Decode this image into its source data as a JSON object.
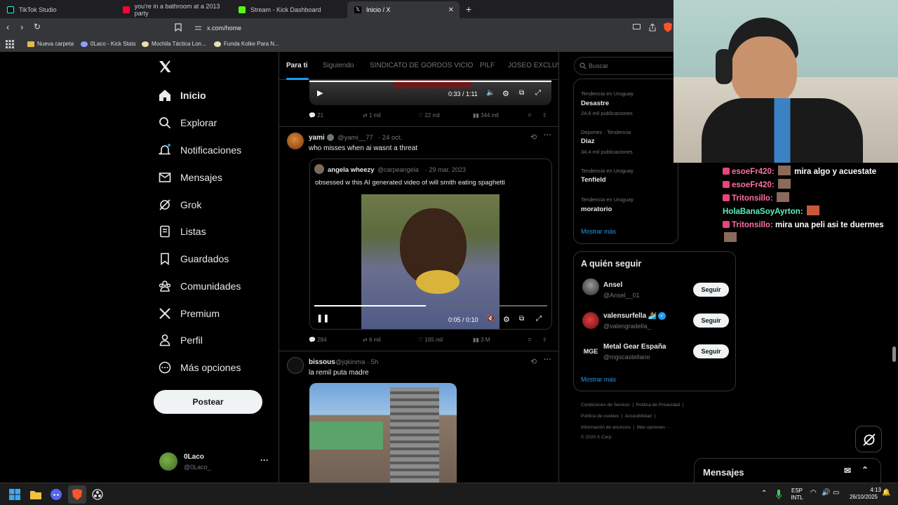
{
  "browser": {
    "tabs": [
      {
        "label": "TikTok Studio",
        "color": "#25f4ee"
      },
      {
        "label": "you're in a bathroom at a 2013 party",
        "color": "#ff0033"
      },
      {
        "label": "Stream - Kick Dashboard",
        "color": "#53fc18"
      },
      {
        "label": "Inicio / X",
        "color": "#ffffff"
      }
    ],
    "url": "x.com/home",
    "bookmarks": [
      "Nueva carpeta",
      "0Laco - Kick Stats",
      "Mochila Táctica Lon...",
      "Funda Kolke Para N..."
    ]
  },
  "nav": {
    "items": [
      "Inicio",
      "Explorar",
      "Notificaciones",
      "Mensajes",
      "Grok",
      "Listas",
      "Guardados",
      "Comunidades",
      "Premium",
      "Perfil",
      "Más opciones"
    ],
    "post_label": "Postear",
    "account_name": "0Laco",
    "account_handle": "@0Laco_"
  },
  "feed": {
    "tabs": [
      "Para ti",
      "Siguiendo",
      "SINDICATO DE GORDOS VICIO",
      "PILF",
      "JOSEO EXCLUSIV"
    ],
    "top_video": {
      "time": "0:33 / 1:11"
    },
    "top_actions": {
      "replies": "21",
      "reposts": "1 mil",
      "likes": "22 mil",
      "views": "344 mil"
    },
    "post1": {
      "name": "yami",
      "handle": "@yami__77",
      "date": "· 24 oct.",
      "text": "who misses when ai wasnt a threat",
      "quote_name": "angela wheezy",
      "quote_handle": "@carpeangela",
      "quote_date": "· 29 mar. 2023",
      "quote_text": "obsessed w this AI generated video of will smith eating spaghetti",
      "video_time": "0:05 / 0:10",
      "video_progress": 0.48,
      "replies": "284",
      "reposts": "6 mil",
      "likes": "165 mil",
      "views": "3 M"
    },
    "post2": {
      "name": "bissous",
      "handle": "@jqkinma",
      "date": "· 5h",
      "text": "la remil puta madre"
    }
  },
  "sidebar": {
    "search_placeholder": "Buscar",
    "trends": [
      {
        "label": "Tendencia en Uruguay",
        "name": "Desastre",
        "count": "24,6 mil publicaciones"
      },
      {
        "label": "Deportes · Tendencia",
        "name": "Diaz",
        "count": "34,4 mil publicaciones"
      },
      {
        "label": "Tendencia en Uruguay",
        "name": "Tenfield",
        "count": ""
      },
      {
        "label": "Tendencia en Uruguay",
        "name": "moratorio",
        "count": ""
      }
    ],
    "show_more": "Mostrar más",
    "follow_title": "A quién seguir",
    "follow": [
      {
        "name": "Ansel",
        "handle": "@Ansel__01",
        "button": "Seguir"
      },
      {
        "name": "valensurfella 🏄",
        "handle": "@valengradella_",
        "button": "Seguir"
      },
      {
        "name": "Metal Gear España",
        "handle": "@mgscastellano",
        "button": "Seguir"
      }
    ],
    "follow_more": "Mostrar más",
    "footer": [
      "Condiciones de Servicio",
      "Política de Privacidad",
      "Política de cookies",
      "Accesibilidad",
      "Información de anuncios",
      "Más opciones ···",
      "© 2025 X Corp."
    ],
    "messages": "Mensajes"
  },
  "chat": [
    {
      "user": "esoeFr420:",
      "text": "mira algo y acuestate"
    },
    {
      "user": "esoeFr420:",
      "text": ""
    },
    {
      "user": "Tritonsillo:",
      "text": ""
    },
    {
      "user": "HolaBanaSoyAyrton:",
      "text": ""
    },
    {
      "user": "Tritonsillo:",
      "text": "mira una peli asi te duermes"
    }
  ],
  "taskbar": {
    "lang": "ESP",
    "layout": "INTL",
    "time": "4:13",
    "date": "26/10/2025"
  }
}
